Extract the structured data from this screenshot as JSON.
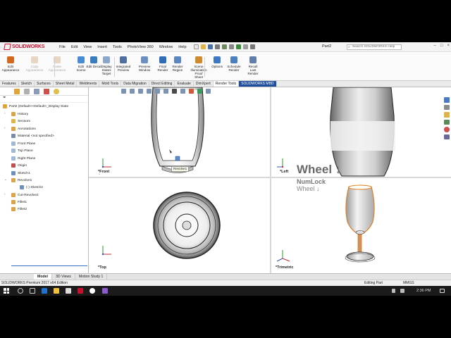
{
  "app": {
    "brand": "SOLIDWORKS",
    "document_name": "Part2",
    "search_placeholder": "Search SOLIDWORKS Help"
  },
  "menu": [
    "File",
    "Edit",
    "View",
    "Insert",
    "Tools",
    "PhotoView 360",
    "Window",
    "Help"
  ],
  "ribbon": {
    "buttons": [
      {
        "label": "Edit Appearance",
        "icon": "edit-appearance-icon",
        "color": "#d2691e",
        "dim": false
      },
      {
        "label": "Copy Appearance",
        "icon": "copy-appearance-icon",
        "color": "#c8a070",
        "dim": true
      },
      {
        "label": "Paste Appearance",
        "icon": "paste-appearance-icon",
        "color": "#c8a070",
        "dim": true
      },
      {
        "label": "Edit Scene",
        "icon": "edit-scene-icon",
        "color": "#4a8bd6",
        "dim": false
      },
      {
        "label": "Edit Decal",
        "icon": "edit-decal-icon",
        "color": "#3a7abf",
        "dim": false
      },
      {
        "label": "Display States Target",
        "icon": "display-states-icon",
        "color": "#8aa6c8",
        "dim": false
      },
      {
        "label": "Integrated Preview",
        "icon": "integrated-preview-icon",
        "color": "#4f6f9f",
        "dim": false
      },
      {
        "label": "Preview Window",
        "icon": "preview-window-icon",
        "color": "#6a8fc0",
        "dim": false
      },
      {
        "label": "Final Render",
        "icon": "final-render-icon",
        "color": "#2f6db5",
        "dim": false
      },
      {
        "label": "Render Region",
        "icon": "render-region-icon",
        "color": "#5a86c4",
        "dim": false
      },
      {
        "label": "Scene Illumination Proof Sheet",
        "icon": "scene-illumination-icon",
        "color": "#d08a2a",
        "dim": false
      },
      {
        "label": "Options",
        "icon": "options-icon",
        "color": "#3d78c4",
        "dim": false
      },
      {
        "label": "Schedule Render",
        "icon": "schedule-render-icon",
        "color": "#4c7fc0",
        "dim": false
      },
      {
        "label": "Recall Last Render",
        "icon": "recall-render-icon",
        "color": "#5f7ea8",
        "dim": false
      }
    ]
  },
  "tabs": [
    "Features",
    "Sketch",
    "Surfaces",
    "Sheet Metal",
    "Weldments",
    "Mold Tools",
    "Data Migration",
    "Direct Editing",
    "Evaluate",
    "DimXpert",
    "Render Tools",
    "SOLIDWORKS MBD"
  ],
  "feature_tree": {
    "root": "Part2  (Default<<Default>_Display State",
    "items": [
      {
        "label": "History",
        "icon": "history-icon",
        "color": "#d9a44a"
      },
      {
        "label": "Sensors",
        "icon": "sensors-icon",
        "color": "#e0b34a"
      },
      {
        "label": "Annotations",
        "icon": "annotations-icon",
        "color": "#d9a44a"
      },
      {
        "label": "Material <not specified>",
        "icon": "material-icon",
        "color": "#7a8ca8"
      },
      {
        "label": "Front Plane",
        "icon": "plane-icon",
        "color": "#9fb8d8"
      },
      {
        "label": "Top Plane",
        "icon": "plane-icon",
        "color": "#9fb8d8"
      },
      {
        "label": "Right Plane",
        "icon": "plane-icon",
        "color": "#9fb8d8"
      },
      {
        "label": "Origin",
        "icon": "origin-icon",
        "color": "#c05050"
      },
      {
        "label": "Sketch1",
        "icon": "sketch-icon",
        "color": "#6a8fc0"
      },
      {
        "label": "Revolve1",
        "icon": "revolve-icon",
        "color": "#d9a44a"
      },
      {
        "label": "(-) Sketch2",
        "icon": "sketch-icon",
        "color": "#6a8fc0"
      },
      {
        "label": "Cut-Revolve2",
        "icon": "cut-revolve-icon",
        "color": "#d9a44a"
      },
      {
        "label": "Fillet1",
        "icon": "fillet-icon",
        "color": "#d9a44a"
      },
      {
        "label": "Fillet2",
        "icon": "fillet-icon",
        "color": "#d9a44a"
      }
    ]
  },
  "viewports": {
    "front": "*Front",
    "left": "*Left",
    "top": "*Top",
    "trimetric": "*Trimetric"
  },
  "tooltip": "Revolve1",
  "overlay": {
    "line1": "Wheel ↓",
    "line2": "NumLock",
    "line3": "Wheel ↓"
  },
  "bottom_tabs": [
    "Model",
    "3D Views",
    "Motion Study 1"
  ],
  "status": {
    "edition": "SOLIDWORKS Premium 2017 x64 Edition",
    "mode": "Editing Part",
    "units": "MMGS"
  },
  "taskbar": {
    "time": "2:36 PM"
  },
  "colors": {
    "accent": "#1f4e9b",
    "brand": "#c8102e",
    "selection_orange": "#e07a1a"
  }
}
